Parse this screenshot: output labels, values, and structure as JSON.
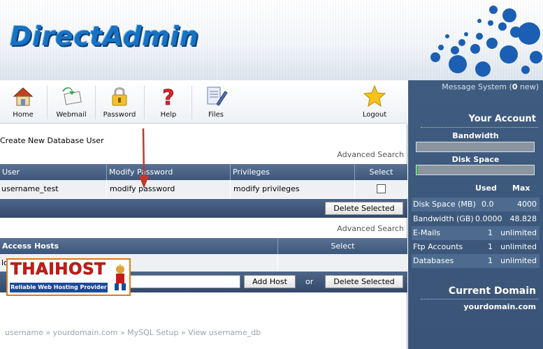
{
  "brand": {
    "logo_text": "DirectAdmin"
  },
  "toolbar": {
    "items": [
      {
        "label": "Home",
        "icon": "home-icon"
      },
      {
        "label": "Webmail",
        "icon": "webmail-icon"
      },
      {
        "label": "Password",
        "icon": "lock-icon"
      },
      {
        "label": "Help",
        "icon": "help-icon"
      },
      {
        "label": "Files",
        "icon": "files-icon"
      },
      {
        "label": "Logout",
        "icon": "star-logout-icon"
      }
    ]
  },
  "main": {
    "page_title": "Create New Database User",
    "advanced_search_label": "Advanced Search",
    "users_table": {
      "headers": [
        "User",
        "Modify Password",
        "Privileges",
        "Select"
      ],
      "rows": [
        {
          "user": "username_test",
          "modify": "modify password",
          "privileges": "modify privileges",
          "selected": false
        }
      ],
      "delete_button": "Delete Selected"
    },
    "hosts_table": {
      "advanced_search_label": "Advanced Search",
      "headers": [
        "Access Hosts",
        "Select"
      ],
      "rows": [
        {
          "host": "lo"
        }
      ],
      "host_input_value": "",
      "add_button": "Add Host",
      "or_text": "or",
      "delete_button": "Delete Selected"
    },
    "breadcrumb": "username » yourdomain.com » MySQL Setup » View username_db"
  },
  "sidebar": {
    "message_system": {
      "prefix": "Message System (",
      "count": "0",
      "suffix": " new)"
    },
    "your_account_title": "Your Account",
    "bandwidth_label": "Bandwidth",
    "bandwidth_usage": 0.0,
    "disk_space_label": "Disk Space",
    "disk_usage": 0.01,
    "stats_headers": {
      "used": "Used",
      "max": "Max"
    },
    "stats": [
      {
        "name": "Disk Space (MB)",
        "used": "0.0",
        "max": "4000"
      },
      {
        "name": "Bandwidth (GB)",
        "used": "0.0000",
        "max": "48.828"
      },
      {
        "name": "E-Mails",
        "used": "1",
        "max": "unlimited"
      },
      {
        "name": "Ftp Accounts",
        "used": "1",
        "max": "unlimited"
      },
      {
        "name": "Databases",
        "used": "1",
        "max": "unlimited"
      }
    ],
    "current_domain_title": "Current Domain",
    "domain": "yourdomain.com"
  },
  "watermark": {
    "title": "THAIHOST",
    "subtitle": "Reliable Web Hosting Provider"
  },
  "colors": {
    "header_blue": "#1772c4",
    "table_header": "#4a6488",
    "sidebar": "#3d587c",
    "watermark_red": "#c81a16"
  }
}
